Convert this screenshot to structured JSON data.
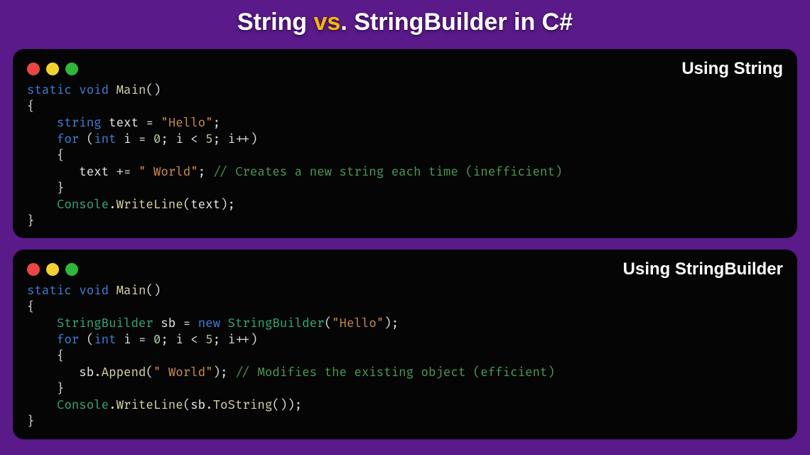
{
  "title": {
    "part1": "String ",
    "vs": "vs",
    "part3": ". StringBuilder in C#"
  },
  "panels": [
    {
      "label": "Using String",
      "code": {
        "l1a": "static",
        "l1b": "void",
        "l1c": "Main",
        "l3a": "string",
        "l3b": "text",
        "l3c": "\"Hello\"",
        "l4a": "for",
        "l4b": "int",
        "l4c": "i",
        "l4d": "0",
        "l4e": "5",
        "l6a": "text",
        "l6b": "\" World\"",
        "l6c": "// Creates a new string each time (inefficient)",
        "l8a": "Console",
        "l8b": "WriteLine",
        "l8c": "text"
      }
    },
    {
      "label": "Using StringBuilder",
      "code": {
        "l1a": "static",
        "l1b": "void",
        "l1c": "Main",
        "l3a": "StringBuilder",
        "l3b": "sb",
        "l3c": "new",
        "l3d": "StringBuilder",
        "l3e": "\"Hello\"",
        "l4a": "for",
        "l4b": "int",
        "l4c": "i",
        "l4d": "0",
        "l4e": "5",
        "l6a": "sb",
        "l6b": "Append",
        "l6c": "\" World\"",
        "l6d": "// Modifies the existing object (efficient)",
        "l8a": "Console",
        "l8b": "WriteLine",
        "l8c": "sb",
        "l8d": "ToString"
      }
    }
  ]
}
